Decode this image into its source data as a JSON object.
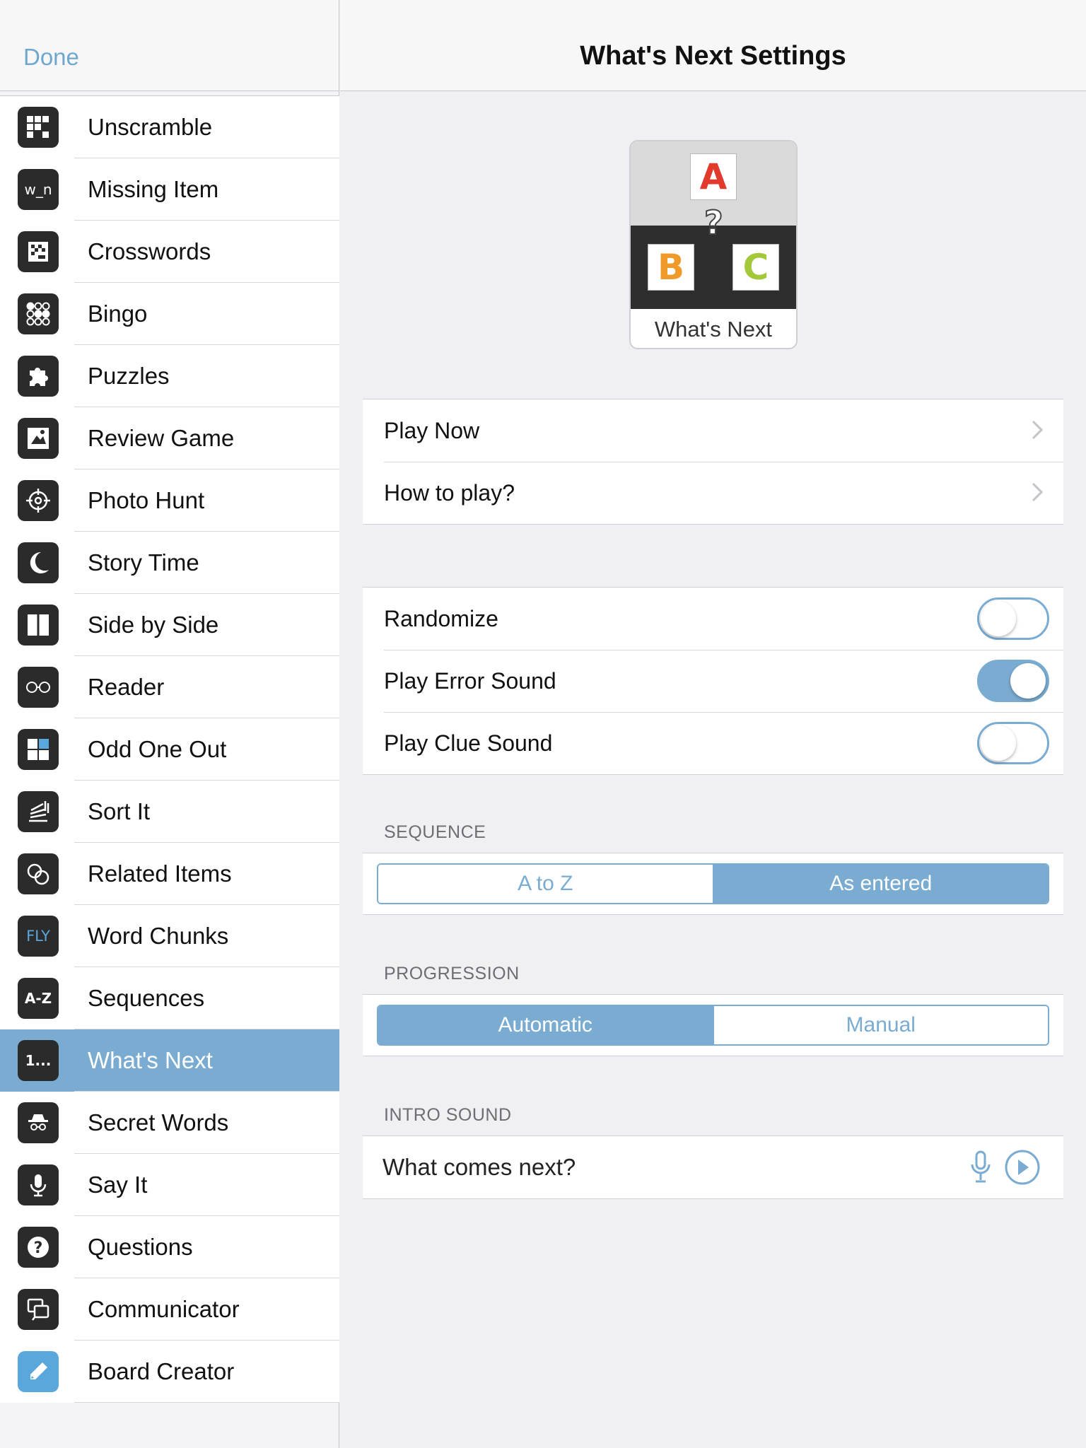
{
  "sidebar": {
    "done_label": "Done",
    "items": [
      {
        "label": "Unscramble",
        "icon": "unscramble-icon"
      },
      {
        "label": "Missing Item",
        "icon": "missing-item-icon",
        "icon_text": "w_n"
      },
      {
        "label": "Crosswords",
        "icon": "crosswords-icon"
      },
      {
        "label": "Bingo",
        "icon": "bingo-icon"
      },
      {
        "label": "Puzzles",
        "icon": "puzzle-icon"
      },
      {
        "label": "Review Game",
        "icon": "review-game-icon"
      },
      {
        "label": "Photo Hunt",
        "icon": "crosshair-icon"
      },
      {
        "label": "Story Time",
        "icon": "moon-icon"
      },
      {
        "label": "Side by Side",
        "icon": "side-by-side-icon"
      },
      {
        "label": "Reader",
        "icon": "glasses-icon"
      },
      {
        "label": "Odd One Out",
        "icon": "odd-one-out-icon"
      },
      {
        "label": "Sort It",
        "icon": "sort-it-icon"
      },
      {
        "label": "Related Items",
        "icon": "related-items-icon"
      },
      {
        "label": "Word Chunks",
        "icon": "word-chunks-icon",
        "icon_text": "FLY"
      },
      {
        "label": "Sequences",
        "icon": "sequences-icon",
        "icon_text": "A-Z"
      },
      {
        "label": "What's Next",
        "icon": "whats-next-icon",
        "icon_text": "1...",
        "selected": true
      },
      {
        "label": "Secret Words",
        "icon": "spy-icon"
      },
      {
        "label": "Say It",
        "icon": "microphone-icon"
      },
      {
        "label": "Questions",
        "icon": "question-icon"
      },
      {
        "label": "Communicator",
        "icon": "communicator-icon"
      },
      {
        "label": "Board Creator",
        "icon": "pencil-icon"
      }
    ]
  },
  "header": {
    "title": "What's Next Settings"
  },
  "preview": {
    "tile_a": "A",
    "tile_b": "B",
    "tile_c": "C",
    "question": "?",
    "label": "What's Next"
  },
  "actions": {
    "play_now": "Play Now",
    "how_to_play": "How to play?"
  },
  "options": {
    "randomize": {
      "label": "Randomize",
      "on": false
    },
    "play_error_sound": {
      "label": "Play Error Sound",
      "on": true
    },
    "play_clue_sound": {
      "label": "Play Clue Sound",
      "on": false
    }
  },
  "sequence": {
    "header": "SEQUENCE",
    "options": [
      "A to Z",
      "As entered"
    ],
    "selected": "As entered"
  },
  "progression": {
    "header": "PROGRESSION",
    "options": [
      "Automatic",
      "Manual"
    ],
    "selected": "Automatic"
  },
  "intro_sound": {
    "header": "INTRO SOUND",
    "text": "What comes next?"
  },
  "colors": {
    "accent": "#7aacd2",
    "selected_row": "#7aacd2",
    "icon_dark": "#2b2b2b",
    "icon_blue": "#5aa7dc"
  }
}
